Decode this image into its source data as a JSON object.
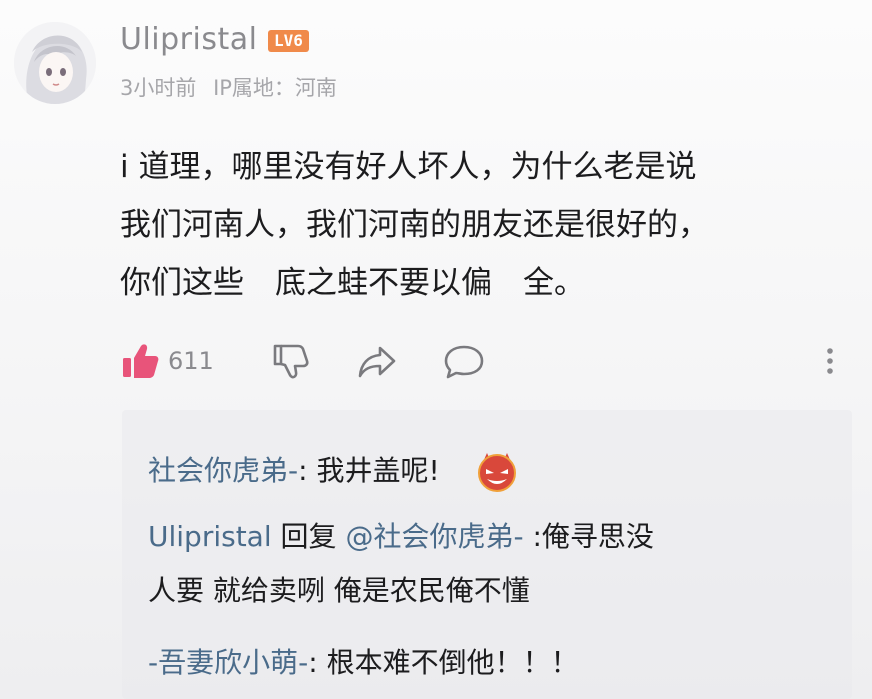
{
  "comment": {
    "username": "Ulipristal",
    "level": "LV6",
    "time": "3小时前",
    "ip_location": "IP属地：河南",
    "body_lines": [
      "i 道理，哪里没有好人坏人，为什么老是说",
      "我们河南人，我们河南的朋友还是很好的，",
      "你们这些　底之蛙不要以偏　全。"
    ],
    "like_count": "611"
  },
  "icons": {
    "like": "thumbs-up-icon",
    "dislike": "thumbs-down-icon",
    "share": "share-icon",
    "reply": "comment-bubble-icon",
    "more": "more-vertical-icon"
  },
  "colors": {
    "like_accent": "#e8547a",
    "link_blue": "#4a6b8a",
    "level_badge": "#f08a4a"
  },
  "replies": [
    {
      "author": "社会你虎弟-",
      "separator": ": ",
      "text": "我井盖呢!",
      "emoji": "red-devil-emoji"
    },
    {
      "author": "Ulipristal",
      "reply_word": " 回复 ",
      "mention": "@社会你虎弟-",
      "separator": " :",
      "text_line1": "俺寻思没",
      "text_line2": "人要 就给卖咧 俺是农民俺不懂"
    },
    {
      "author": "-吾妻欣小萌-",
      "separator": ": ",
      "text": "根本难不倒他！！！"
    }
  ]
}
